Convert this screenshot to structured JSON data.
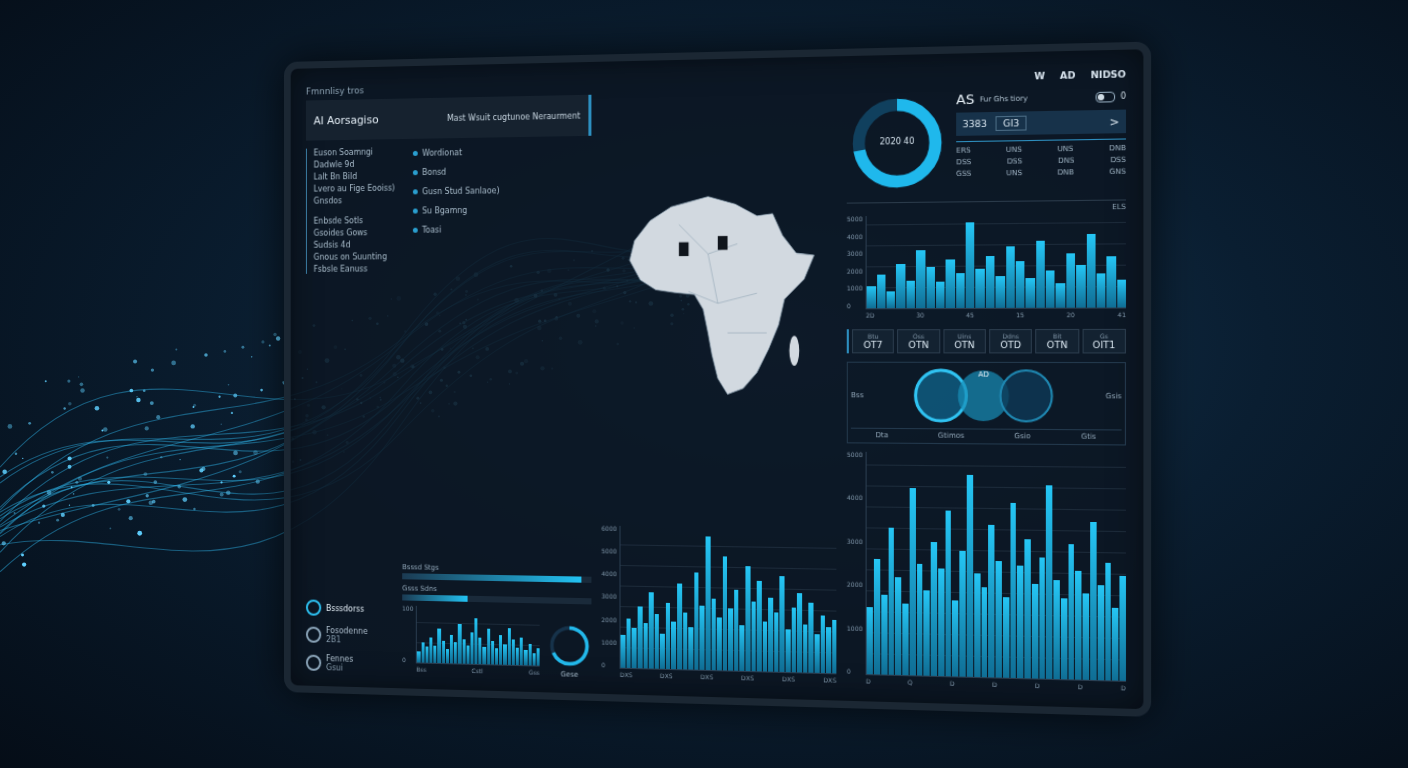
{
  "header": {
    "caption": "Fmnnlisy tros",
    "title": "Al Aorsagiso",
    "subtitle": "Mast Wsuit cugtunoe Neraurment"
  },
  "nav_list": [
    "Euson Soamngi",
    "Dadwle 9d",
    "Lalt Bn Bild",
    "Lvero au Fige Eooiss)",
    "Gnsdos",
    "Enbsde Sotls",
    "Gsoides Gows",
    "Sudsis 4d",
    "Gnous on Suunting",
    "Fsbsle Eanuss"
  ],
  "bullet_list": [
    "Wordionat",
    "Bonsd",
    "Gusn Stud Sanlaoe)",
    "Su Bgamng",
    "Toasi"
  ],
  "brand": [
    "W",
    "AD",
    "NIDSO"
  ],
  "donut": {
    "label": "2020 40",
    "level": 0.72
  },
  "summary_card": {
    "title": "AS",
    "subtitle": "Fur Ghs tiory",
    "toggle": {
      "label": "0",
      "on": false
    },
    "value": "3383",
    "code": "GI3",
    "arrow": ">",
    "rows": [
      [
        "ERS",
        "UNS",
        "UNS",
        "DNB"
      ],
      [
        "DSS",
        "DSS",
        "DNS",
        "DSS"
      ],
      [
        "GSS",
        "UNS",
        "DNB",
        "GNS"
      ]
    ]
  },
  "right_chart": {
    "header": "ELS",
    "ticks": [
      "5000",
      "4000",
      "3000",
      "2000",
      "1000",
      "0"
    ],
    "x_labels": [
      "2D",
      "30",
      "45",
      "15",
      "20",
      "41"
    ],
    "values": [
      1200,
      1800,
      900,
      2400,
      1500,
      3100,
      2200,
      1400,
      2600,
      1900,
      4600,
      2100,
      2800,
      1700,
      3300,
      2500,
      1600,
      3600,
      2000,
      1300,
      2900,
      2300,
      3900,
      1800,
      2700,
      1500
    ]
  },
  "stat_tiles": [
    {
      "label": "Btu",
      "value": "OT7"
    },
    {
      "label": "Oss",
      "value": "OTN"
    },
    {
      "label": "Uins",
      "value": "OTN"
    },
    {
      "label": "Ddns",
      "value": "OTD"
    },
    {
      "label": "Bit",
      "value": "OTN"
    },
    {
      "label": "Gs",
      "value": "OIT1"
    }
  ],
  "venn": {
    "title": "AD",
    "left_label": "Bss",
    "right_label": "Gsis",
    "footer": [
      "Dta",
      "Gtimos",
      "Gsio",
      "Gtis"
    ]
  },
  "side_items": [
    {
      "label": "Bsssdorss",
      "sub": "",
      "selected": true
    },
    {
      "label": "Fosodenne",
      "sub": "2B1",
      "selected": false
    },
    {
      "label": "Fennes",
      "sub": "Gsui",
      "selected": false
    }
  ],
  "progress": [
    {
      "label": "Bsssd Stgs",
      "level": 0.95
    },
    {
      "label": "Gsss Sdns",
      "level": 0.35
    }
  ],
  "small_chart": {
    "ticks": [
      "100",
      "0"
    ],
    "x_labels": [
      "Bss",
      "Cstl",
      "Gss"
    ],
    "values": [
      20,
      35,
      28,
      45,
      30,
      60,
      40,
      25,
      50,
      38,
      70,
      42,
      33,
      55,
      80,
      46,
      30,
      62,
      41,
      28,
      52,
      36,
      65,
      44,
      30,
      48,
      26,
      38,
      22,
      30
    ]
  },
  "gauge": {
    "label": "Gese",
    "level": 0.68
  },
  "bottom_chart": {
    "ticks": [
      "6000",
      "5000",
      "4000",
      "3000",
      "2000",
      "1000",
      "0"
    ],
    "x_labels": [
      "DXS",
      "DXS",
      "DXS",
      "DXS",
      "DXS",
      "DXS"
    ],
    "values": [
      1400,
      2100,
      1700,
      2600,
      1900,
      3200,
      2300,
      1500,
      2800,
      2000,
      3600,
      2400,
      1800,
      4100,
      2700,
      5600,
      3000,
      2200,
      4800,
      2600,
      3400,
      1900,
      4400,
      2900,
      3800,
      2100,
      3100,
      2500,
      4000,
      1800,
      2700,
      3300,
      2000,
      2900,
      1600,
      2400,
      1900,
      2200
    ]
  },
  "corner_chart": {
    "ticks": [
      "5000",
      "4000",
      "3000",
      "2000",
      "1000",
      "0"
    ],
    "x_labels": [
      "D",
      "Q",
      "D",
      "D",
      "D",
      "D",
      "D"
    ],
    "values": [
      1500,
      2600,
      1800,
      3300,
      2200,
      1600,
      4200,
      2500,
      1900,
      3000,
      2400,
      3700,
      1700,
      2800,
      4500,
      2300,
      2000,
      3400,
      2600,
      1800,
      3900,
      2500,
      3100,
      2100,
      2700,
      4300,
      2200,
      1800,
      3000,
      2400,
      1900,
      3500,
      2100,
      2600,
      1600,
      2300
    ]
  }
}
